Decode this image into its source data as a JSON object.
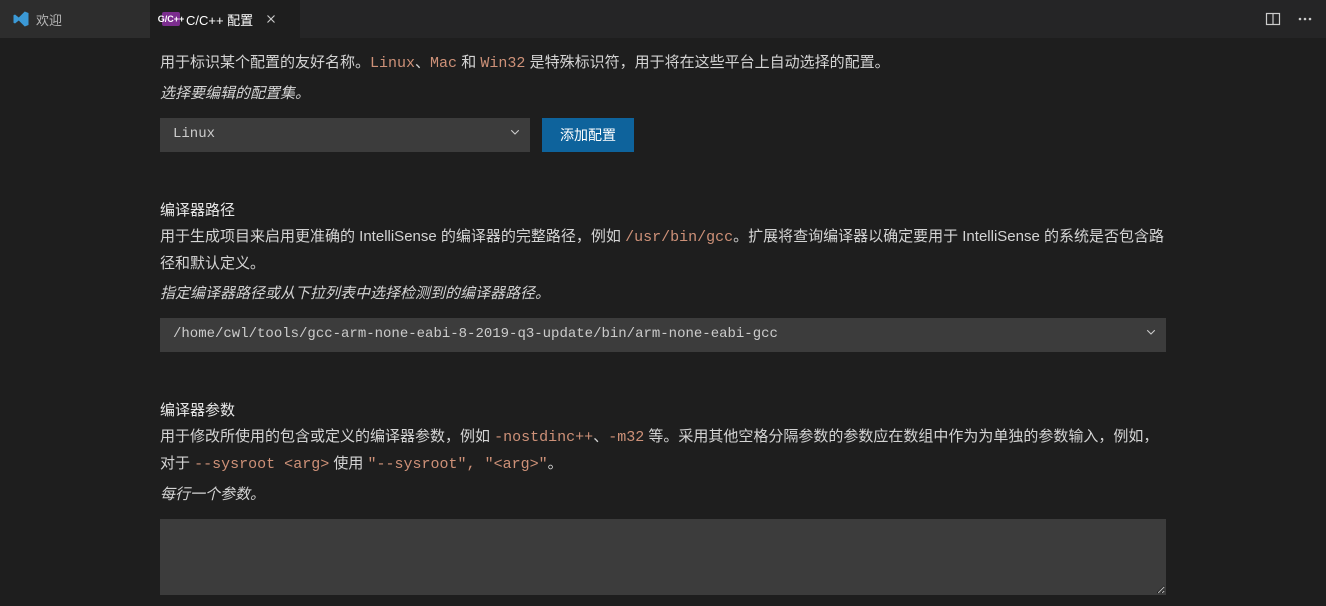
{
  "tabs": {
    "inactive": {
      "label": "欢迎"
    },
    "active": {
      "icon_text": "G/C++",
      "label": "C/C++ 配置"
    }
  },
  "section_name": {
    "desc_pre": "用于标识某个配置的友好名称。",
    "code1": "Linux",
    "sep1": "、",
    "code2": "Mac",
    "mid": " 和 ",
    "code3": "Win32",
    "desc_post": " 是特殊标识符，用于将在这些平台上自动选择的配置。",
    "hint": "选择要编辑的配置集。",
    "select_value": "Linux",
    "add_button": "添加配置"
  },
  "section_compiler": {
    "title": "编译器路径",
    "desc_pre": "用于生成项目来启用更准确的 IntelliSense 的编译器的完整路径，例如 ",
    "code1": "/usr/bin/gcc",
    "desc_post": "。扩展将查询编译器以确定要用于 IntelliSense 的系统是否包含路径和默认定义。",
    "hint": "指定编译器路径或从下拉列表中选择检测到的编译器路径。",
    "select_value": "/home/cwl/tools/gcc-arm-none-eabi-8-2019-q3-update/bin/arm-none-eabi-gcc"
  },
  "section_args": {
    "title": "编译器参数",
    "desc_pre": "用于修改所使用的包含或定义的编译器参数，例如 ",
    "code1": "-nostdinc++",
    "sep1": "、",
    "code2": "-m32",
    "mid": " 等。采用其他空格分隔参数的参数应在数组中作为为单独的参数输入，例如，对于 ",
    "code3": "--sysroot <arg>",
    "mid2": " 使用 ",
    "code4": "\"--sysroot\", \"<arg>\"",
    "desc_post": "。",
    "hint": "每行一个参数。",
    "textarea_value": ""
  }
}
